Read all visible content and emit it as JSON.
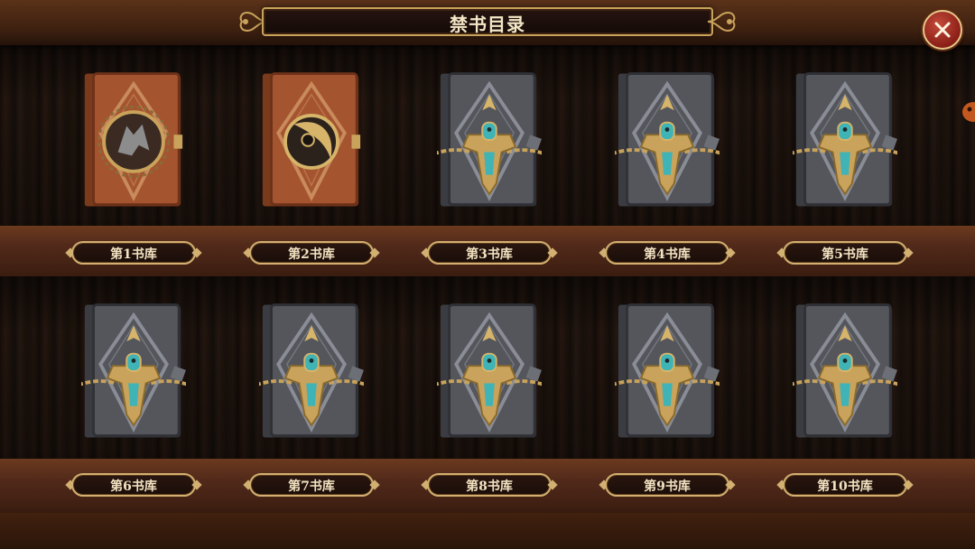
{
  "title": "禁书目录",
  "close_icon": "close-icon",
  "colors": {
    "gold": "#d2b071",
    "brown_book": "#a65a34",
    "gray_book": "#5a5c62",
    "close_red": "#a83226"
  },
  "libraries": [
    {
      "label": "第1书库",
      "state": "unlocked",
      "emblem": "wolf-emblem-icon"
    },
    {
      "label": "第2书库",
      "state": "unlocked",
      "emblem": "eye-emblem-icon"
    },
    {
      "label": "第3书库",
      "state": "locked",
      "emblem": "lock-emblem-icon"
    },
    {
      "label": "第4书库",
      "state": "locked",
      "emblem": "lock-emblem-icon"
    },
    {
      "label": "第5书库",
      "state": "locked",
      "emblem": "lock-emblem-icon"
    },
    {
      "label": "第6书库",
      "state": "locked",
      "emblem": "lock-emblem-icon"
    },
    {
      "label": "第7书库",
      "state": "locked",
      "emblem": "lock-emblem-icon"
    },
    {
      "label": "第8书库",
      "state": "locked",
      "emblem": "lock-emblem-icon"
    },
    {
      "label": "第9书库",
      "state": "locked",
      "emblem": "lock-emblem-icon"
    },
    {
      "label": "第10书库",
      "state": "locked",
      "emblem": "lock-emblem-icon"
    }
  ]
}
